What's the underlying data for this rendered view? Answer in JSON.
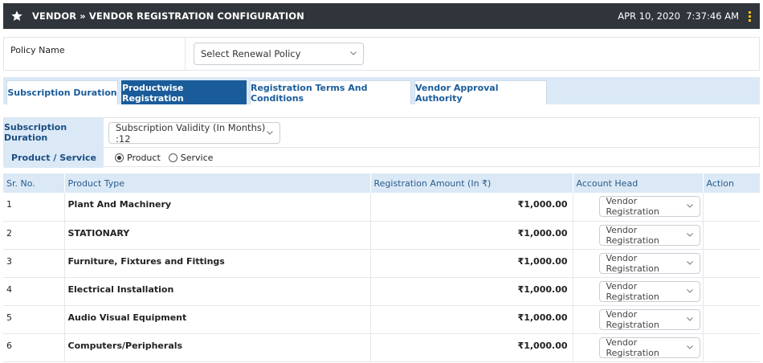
{
  "header": {
    "title": "VENDOR » VENDOR REGISTRATION CONFIGURATION",
    "date": "APR 10, 2020",
    "time": "7:37:46 AM"
  },
  "policy": {
    "label": "Policy Name",
    "select_value": "Select Renewal Policy"
  },
  "tabs": [
    {
      "label": "Subscription Duration",
      "active": false
    },
    {
      "label": "Productwise Registration",
      "active": true
    },
    {
      "label": "Registration Terms And Conditions",
      "active": false
    },
    {
      "label": "Vendor Approval Authority",
      "active": false
    }
  ],
  "subscription": {
    "duration_label": "Subscription Duration",
    "validity_value": "Subscription Validity (In Months) :12",
    "product_service_label": "Product / Service",
    "options": [
      {
        "label": "Product",
        "selected": true
      },
      {
        "label": "Service",
        "selected": false
      }
    ]
  },
  "table": {
    "headers": [
      "Sr. No.",
      "Product Type",
      "Registration Amount (In ₹)",
      "Account Head",
      "Action"
    ],
    "rows": [
      {
        "sr": "1",
        "product": "Plant And Machinery",
        "amount": "₹1,000.00",
        "account": "Vendor Registration"
      },
      {
        "sr": "2",
        "product": "STATIONARY",
        "amount": "₹1,000.00",
        "account": "Vendor Registration"
      },
      {
        "sr": "3",
        "product": "Furniture, Fixtures and Fittings",
        "amount": "₹1,000.00",
        "account": "Vendor Registration"
      },
      {
        "sr": "4",
        "product": "Electrical Installation",
        "amount": "₹1,000.00",
        "account": "Vendor Registration"
      },
      {
        "sr": "5",
        "product": "Audio Visual Equipment",
        "amount": "₹1,000.00",
        "account": "Vendor Registration"
      },
      {
        "sr": "6",
        "product": "Computers/Peripherals",
        "amount": "₹1,000.00",
        "account": "Vendor Registration"
      }
    ]
  },
  "colors": {
    "topbar": "#30353b",
    "accent": "#1a5c9a",
    "tab_strip": "#dbe9f6",
    "kebab": "#f5c21b"
  }
}
